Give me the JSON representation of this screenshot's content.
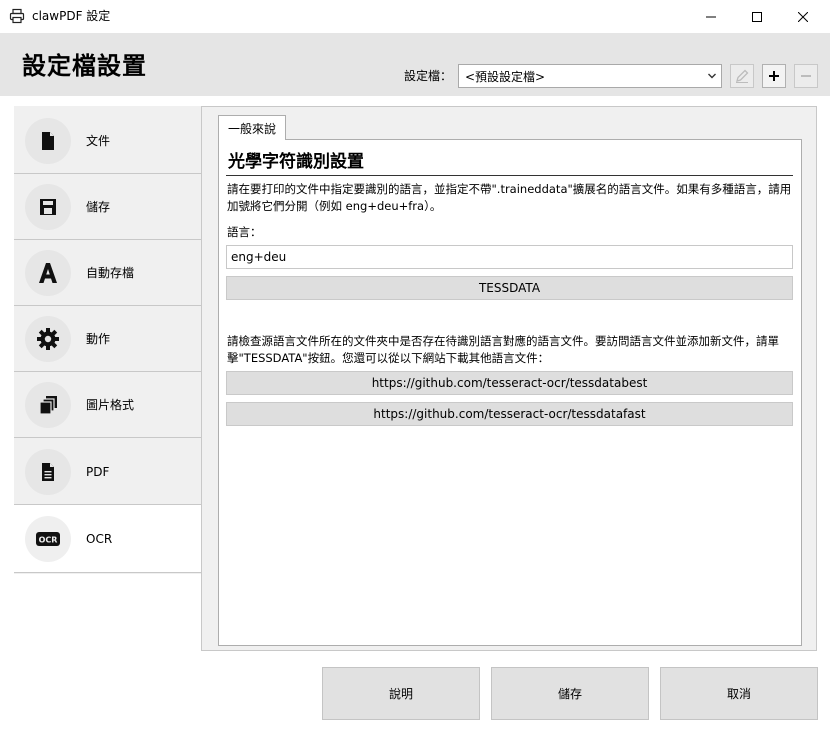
{
  "window": {
    "title": "clawPDF 設定",
    "controls": {
      "minimize": "minimize-icon",
      "maximize": "maximize-icon",
      "close": "close-icon"
    }
  },
  "header": {
    "title": "設定檔設置",
    "profile_label": "設定檔：",
    "profile_value": "<預設設定檔>",
    "buttons": {
      "rename": "pencil-icon",
      "add": "plus-icon",
      "remove": "minus-icon"
    }
  },
  "sidebar": {
    "items": [
      {
        "label": "文件",
        "icon": "document-icon"
      },
      {
        "label": "儲存",
        "icon": "floppy-disk-icon"
      },
      {
        "label": "自動存檔",
        "icon": "letter-a-icon"
      },
      {
        "label": "動作",
        "icon": "gear-icon"
      },
      {
        "label": "圖片格式",
        "icon": "image-stack-icon"
      },
      {
        "label": "PDF",
        "icon": "pdf-document-icon"
      },
      {
        "label": "OCR",
        "icon": "ocr-icon"
      }
    ],
    "active_index": 6
  },
  "main": {
    "tab_label": "一般來說",
    "section_title": "光學字符識別設置",
    "description": "請在要打印的文件中指定要識別的語言，並指定不帶\".traineddata\"擴展名的語言文件。如果有多種語言，請用加號將它們分開（例如 eng+deu+fra）。",
    "language_label": "語言：",
    "language_value": "eng+deu",
    "tessdata_button": "TESSDATA",
    "info_text": "請檢查源語言文件所在的文件夾中是否存在待識別語言對應的語言文件。要訪問語言文件並添加新文件，請單擊\"TESSDATA\"按鈕。您還可以從以下網站下載其他語言文件：",
    "links": [
      "https://github.com/tesseract-ocr/tessdatabest",
      "https://github.com/tesseract-ocr/tessdatafast"
    ]
  },
  "footer": {
    "help": "說明",
    "save": "儲存",
    "cancel": "取消"
  },
  "colors": {
    "header_bg": "#e5e5e5",
    "sidebar_bg": "#f0f0f0",
    "button_bg": "#e1e1e1",
    "link_button_bg": "#dedede"
  }
}
